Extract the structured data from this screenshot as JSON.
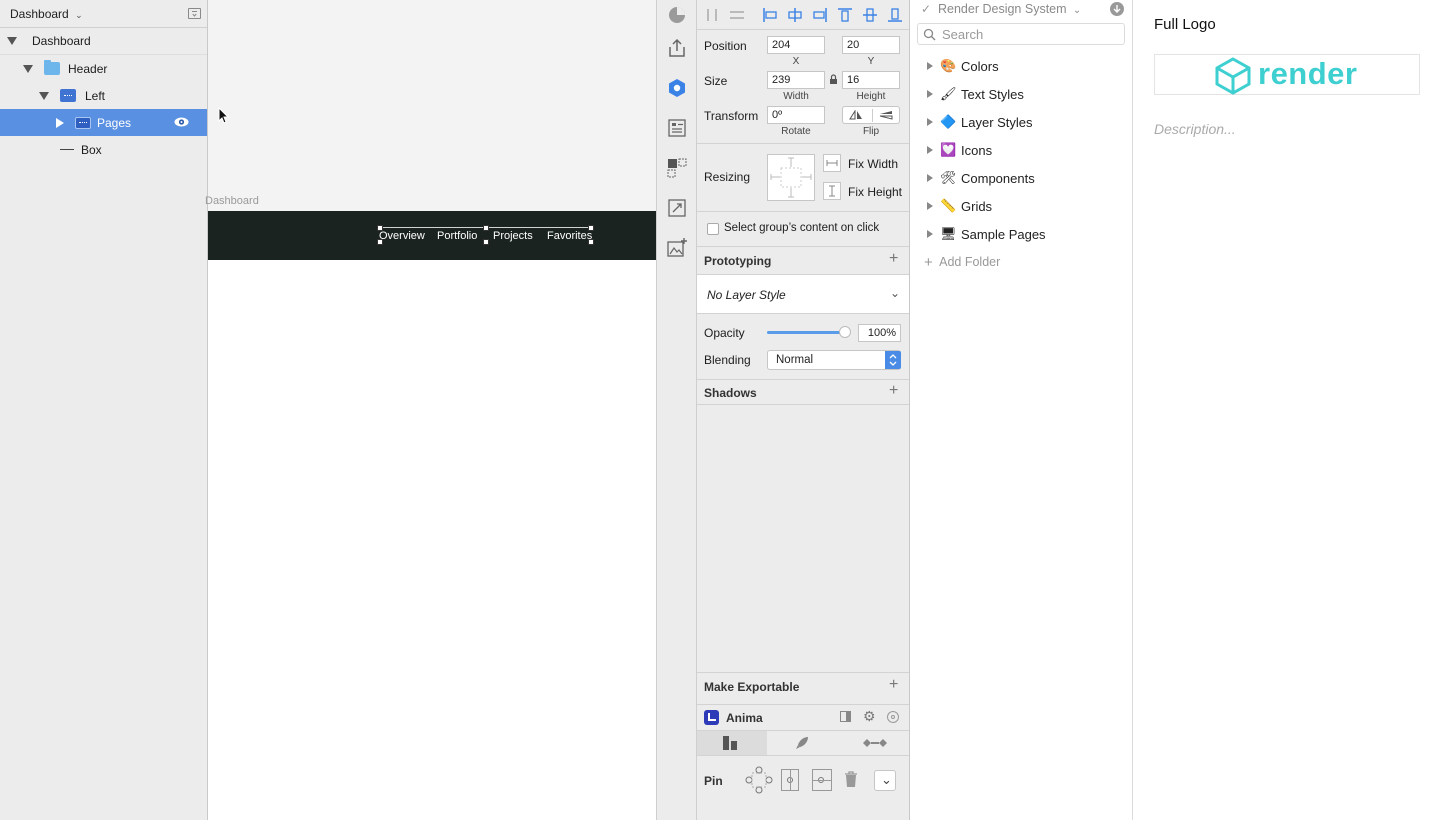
{
  "layers": {
    "page_selector": "Dashboard",
    "rows": [
      {
        "label": "Dashboard"
      },
      {
        "label": "Header"
      },
      {
        "label": "Left"
      },
      {
        "label": "Pages"
      },
      {
        "label": "Box"
      }
    ]
  },
  "canvas": {
    "artboard_label": "Dashboard",
    "nav_links": [
      "Overview",
      "Portfolio",
      "Projects",
      "Favorites"
    ],
    "navbar_color": "#1b2320"
  },
  "inspector": {
    "position_label": "Position",
    "position_x": "204",
    "position_y": "20",
    "x_label": "X",
    "y_label": "Y",
    "size_label": "Size",
    "width": "239",
    "height": "16",
    "width_label": "Width",
    "height_label": "Height",
    "transform_label": "Transform",
    "rotate": "0º",
    "rotate_label": "Rotate",
    "flip_label": "Flip",
    "resizing_label": "Resizing",
    "fix_width": "Fix Width",
    "fix_height": "Fix Height",
    "select_group": "Select group’s content on click",
    "prototyping": "Prototyping",
    "layer_style": "No Layer Style",
    "opacity_label": "Opacity",
    "opacity_value": "100%",
    "opacity_fraction": 1.0,
    "blending_label": "Blending",
    "blending_value": "Normal",
    "shadows": "Shadows",
    "make_exportable": "Make Exportable",
    "anima": "Anima",
    "pin_label": "Pin"
  },
  "library": {
    "title": "Render Design System",
    "search_placeholder": "Search",
    "folders": [
      {
        "label": "Colors",
        "icon": "palette-icon",
        "glyph": "🎨"
      },
      {
        "label": "Text Styles",
        "icon": "brush-icon",
        "glyph": "🖌"
      },
      {
        "label": "Layer Styles",
        "icon": "blue-diamond-icon",
        "glyph": "🔷"
      },
      {
        "label": "Icons",
        "icon": "heart-icon",
        "glyph": "💟"
      },
      {
        "label": "Components",
        "icon": "tools-icon",
        "glyph": "🛠"
      },
      {
        "label": "Grids",
        "icon": "ruler-icon",
        "glyph": "📏"
      },
      {
        "label": "Sample Pages",
        "icon": "desktop-icon",
        "glyph": "🖥"
      }
    ],
    "add_folder": "Add Folder"
  },
  "detail": {
    "title": "Full Logo",
    "logo_text": "render",
    "description_placeholder": "Description...",
    "brand_color": "#3ecfd0"
  },
  "colors": {
    "selection": "#5a90e2",
    "accent_blue": "#3b82e6"
  }
}
